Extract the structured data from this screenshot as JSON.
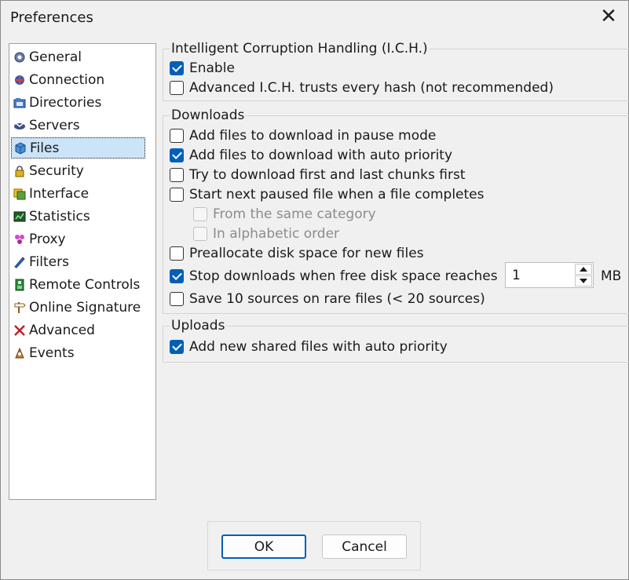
{
  "window": {
    "title": "Preferences"
  },
  "nav": {
    "items": [
      {
        "label": "General",
        "icon": "general-icon"
      },
      {
        "label": "Connection",
        "icon": "connection-icon"
      },
      {
        "label": "Directories",
        "icon": "directories-icon"
      },
      {
        "label": "Servers",
        "icon": "servers-icon"
      },
      {
        "label": "Files",
        "icon": "files-icon",
        "selected": true
      },
      {
        "label": "Security",
        "icon": "lock-icon"
      },
      {
        "label": "Interface",
        "icon": "interface-icon"
      },
      {
        "label": "Statistics",
        "icon": "statistics-icon"
      },
      {
        "label": "Proxy",
        "icon": "proxy-icon"
      },
      {
        "label": "Filters",
        "icon": "filters-icon"
      },
      {
        "label": "Remote Controls",
        "icon": "remote-controls-icon"
      },
      {
        "label": "Online Signature",
        "icon": "signpost-icon"
      },
      {
        "label": "Advanced",
        "icon": "advanced-icon"
      },
      {
        "label": "Events",
        "icon": "events-icon"
      }
    ]
  },
  "ich": {
    "title": "Intelligent Corruption Handling (I.C.H.)",
    "options": [
      {
        "label": "Enable",
        "checked": true
      },
      {
        "label": "Advanced I.C.H. trusts every hash (not recommended)",
        "checked": false
      }
    ]
  },
  "downloads": {
    "title": "Downloads",
    "options": [
      {
        "label": "Add files to download in pause mode",
        "checked": false
      },
      {
        "label": "Add files to download with auto priority",
        "checked": true
      },
      {
        "label": "Try to download first and last chunks first",
        "checked": false
      },
      {
        "label": "Start next paused file when a file completes",
        "checked": false
      },
      {
        "label": "From the same category",
        "checked": false,
        "disabled": true
      },
      {
        "label": "In alphabetic order",
        "checked": false,
        "disabled": true
      },
      {
        "label": "Preallocate disk space for new files",
        "checked": false
      },
      {
        "label": "Stop downloads when free disk space reaches",
        "checked": true
      },
      {
        "label": "Save 10 sources on rare files (< 20 sources)",
        "checked": false
      }
    ],
    "free_space": {
      "value": "1",
      "unit": "MB"
    }
  },
  "uploads": {
    "title": "Uploads",
    "options": [
      {
        "label": "Add new shared files with auto priority",
        "checked": true
      }
    ]
  },
  "buttons": {
    "ok": "OK",
    "cancel": "Cancel"
  },
  "colors": {
    "accent": "#005fb8",
    "selection": "#cce4f7"
  }
}
